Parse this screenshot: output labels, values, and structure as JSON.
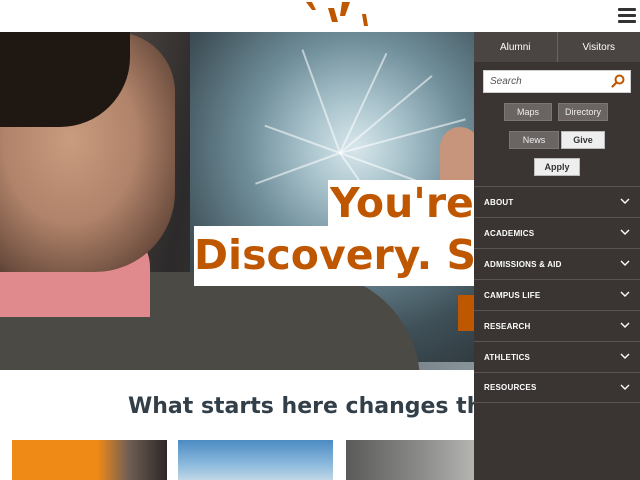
{
  "hero": {
    "headline_line1": "You're Ge",
    "headline_line2": "Discovery. So",
    "tagline": "What starts here changes the world"
  },
  "menu": {
    "tabs": [
      {
        "label": "Alumni"
      },
      {
        "label": "Visitors"
      }
    ],
    "search": {
      "placeholder": "Search"
    },
    "quick_links": [
      {
        "label": "Maps"
      },
      {
        "label": "Directory"
      },
      {
        "label": "News"
      },
      {
        "label": "Give"
      }
    ],
    "apply_label": "Apply",
    "items": [
      {
        "label": "ABOUT"
      },
      {
        "label": "ACADEMICS"
      },
      {
        "label": "ADMISSIONS & AID"
      },
      {
        "label": "CAMPUS LIFE"
      },
      {
        "label": "RESEARCH"
      },
      {
        "label": "ATHLETICS"
      },
      {
        "label": "RESOURCES"
      }
    ]
  },
  "icons": {
    "menu": "hamburger-icon",
    "search": "search-icon",
    "expand": "chevron-down-icon",
    "logo": "tower-logo"
  },
  "colors": {
    "accent": "#bf5700",
    "menu_bg": "#3a3532",
    "heading": "#333f48"
  }
}
